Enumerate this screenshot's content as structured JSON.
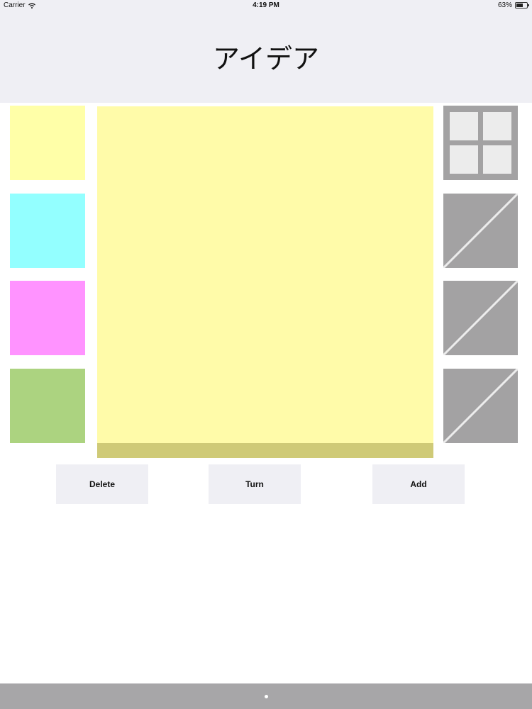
{
  "status_bar": {
    "carrier": "Carrier",
    "time": "4:19 PM",
    "battery_text": "63%",
    "battery_level": 0.63,
    "wifi_icon": "wifi-icon",
    "battery_icon": "battery-icon"
  },
  "header": {
    "title": "アイデア"
  },
  "colors": {
    "header_bg": "#efeff4",
    "swatch_yellow": "#ffffa8",
    "swatch_cyan": "#93ffff",
    "swatch_magenta": "#ff93ff",
    "swatch_green": "#acd380",
    "note_body": "#fffba9",
    "note_footer": "#cfca77",
    "layout_button": "#a3a2a3",
    "home_bar": "#a7a6a8"
  },
  "color_swatches": [
    "yellow",
    "cyan",
    "magenta",
    "green"
  ],
  "layout_buttons": [
    "grid-2x2-icon",
    "diagonal-split-icon",
    "diagonal-split-icon",
    "diagonal-split-icon"
  ],
  "actions": {
    "delete_label": "Delete",
    "turn_label": "Turn",
    "add_label": "Add"
  }
}
